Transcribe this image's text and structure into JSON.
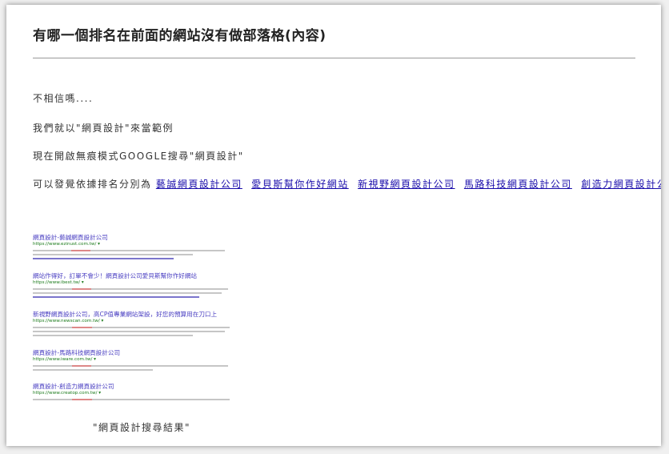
{
  "article": {
    "title": "有哪一個排名在前面的網站沒有做部落格(內容)",
    "para1": "不相信嗎....",
    "para2": "我們就以\"網頁設計\"來當範例",
    "para3": "現在開啟無痕模式GOOGLE搜尋\"網頁設計\"",
    "para4_prefix": "可以發覺依據排名分別為",
    "links": [
      "藝誠網頁設計公司",
      "愛貝斯幫你作好網站",
      "新視野網頁設計公司",
      "馬路科技網頁設計公司",
      "創造力網頁設計公司"
    ],
    "caption": "\"網頁設計搜尋結果\""
  },
  "search_results": [
    {
      "title": "網頁設計-藝誠網頁設計公司",
      "url": "https://www.ezinust.com.tw/ ▾"
    },
    {
      "title": "網站作得好，訂單不會少！網頁設計公司愛貝斯幫你作好網站",
      "url": "https://www.ibest.tw/ ▾"
    },
    {
      "title": "新視野網頁設計公司，高CP值專業網站架設，好您的預算用在刀口上",
      "url": "https://www.newscan.com.tw/ ▾"
    },
    {
      "title": "網頁設計-馬路科技網頁設計公司",
      "url": "https://www.iware.com.tw/ ▾"
    },
    {
      "title": "網頁設計-創造力網頁設計公司",
      "url": "https://www.creatop.com.tw/ ▾"
    }
  ]
}
